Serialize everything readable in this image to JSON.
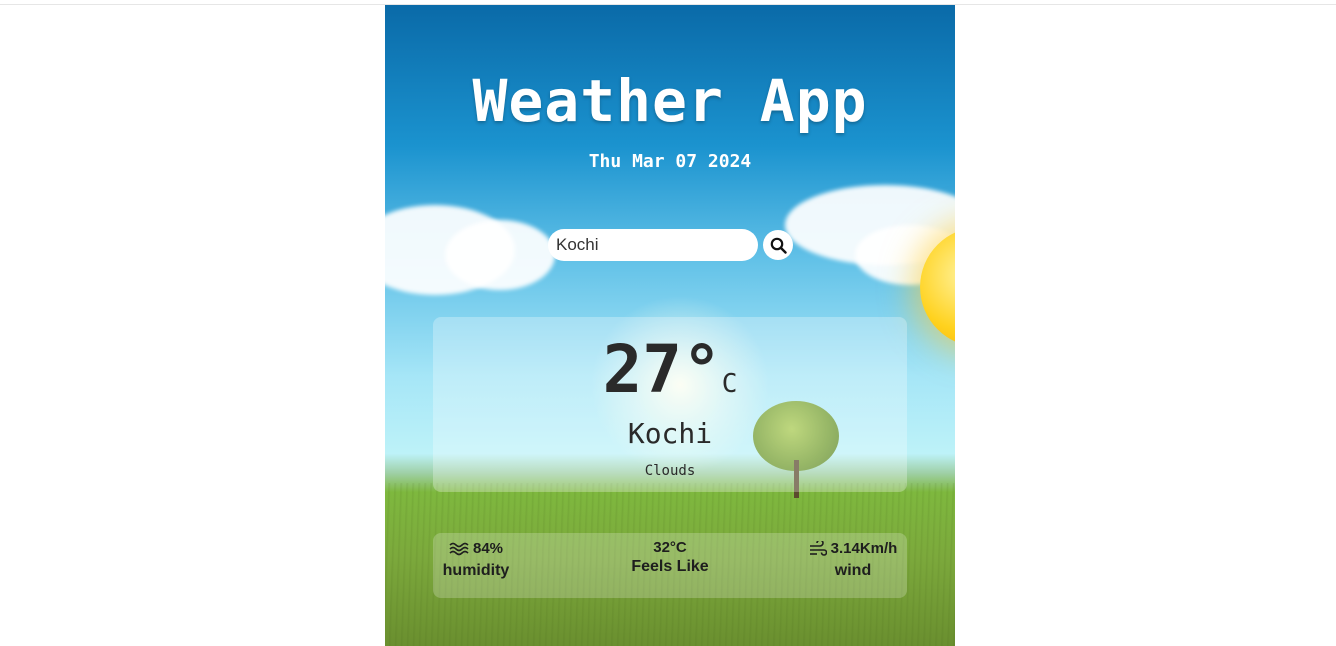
{
  "app": {
    "title": "Weather App",
    "date": "Thu Mar 07 2024"
  },
  "search": {
    "value": "Kochi",
    "placeholder": "Kochi",
    "button_icon": "search-icon"
  },
  "current": {
    "temperature": "27°",
    "unit": "C",
    "city": "Kochi",
    "condition": "Clouds"
  },
  "stats": {
    "humidity": {
      "icon": "humidity-waves-icon",
      "value": "84%",
      "label": "humidity"
    },
    "feels_like": {
      "value": "32°C",
      "label": "Feels Like"
    },
    "wind": {
      "icon": "wind-icon",
      "value": "3.14Km/h",
      "label": "wind"
    }
  },
  "colors": {
    "sky_top": "#0a6aa8",
    "grass": "#7eb83e",
    "text_dark": "#2a2a2a",
    "text_light": "#ffffff"
  }
}
